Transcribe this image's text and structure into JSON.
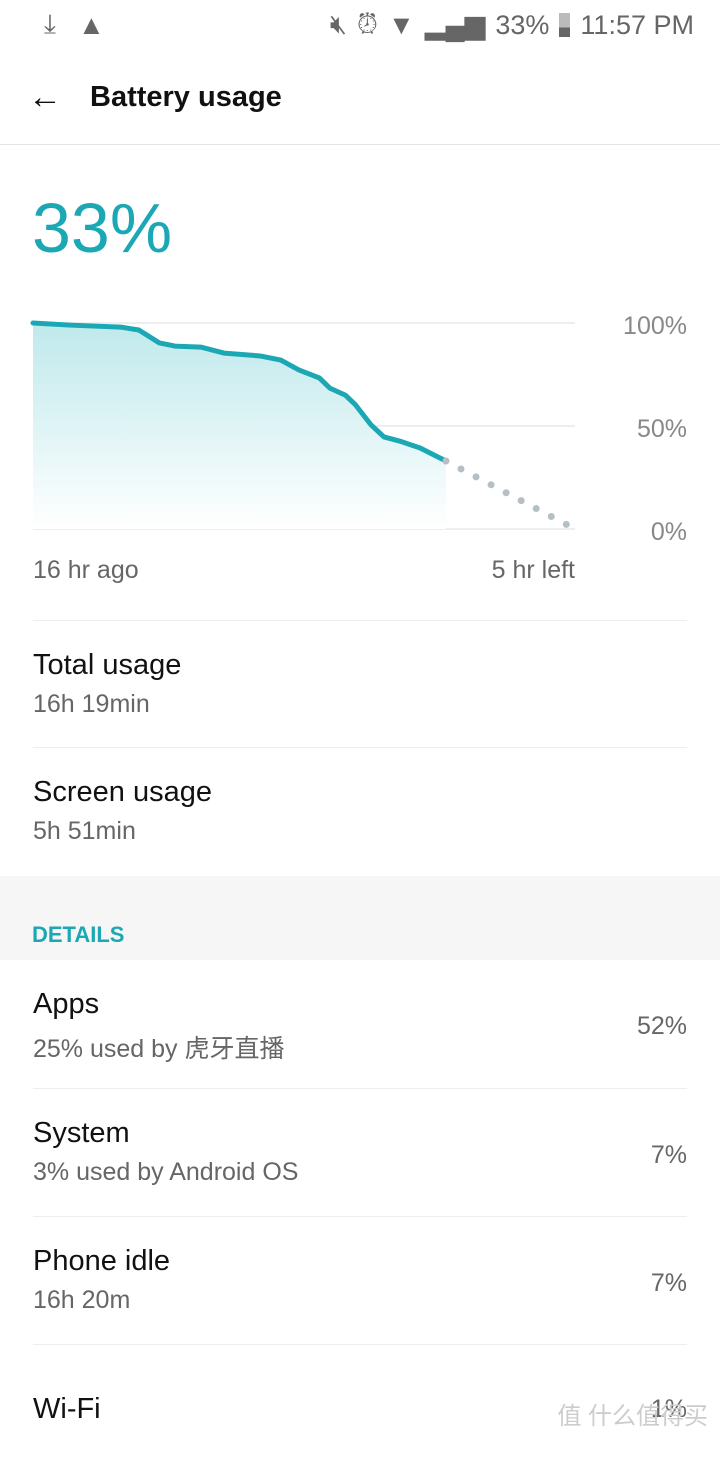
{
  "status_bar": {
    "battery": "33%",
    "time": "11:57 PM",
    "icons": [
      "download-icon",
      "image-icon",
      "mute-icon",
      "alarm-icon",
      "wifi-icon",
      "signal-icon",
      "battery-icon"
    ]
  },
  "header": {
    "title": "Battery usage"
  },
  "battery_level": "33%",
  "accent": "#1ba8b4",
  "chart_data": {
    "type": "area",
    "xlabel": "",
    "ylabel": "",
    "x_labels": [
      "16 hr ago",
      "5 hr left"
    ],
    "y_ticks": [
      "100%",
      "50%",
      "0%"
    ],
    "xlim": [
      -16,
      5
    ],
    "ylim": [
      0,
      100
    ],
    "series": [
      {
        "values": [
          [
            -16,
            100
          ],
          [
            -14.6,
            99
          ],
          [
            -12.6,
            98
          ],
          [
            -11.9,
            96.6
          ],
          [
            -11.1,
            90.3
          ],
          [
            -10.5,
            88.8
          ],
          [
            -9.5,
            88.3
          ],
          [
            -8.6,
            85.4
          ],
          [
            -7.2,
            84
          ],
          [
            -6.4,
            82
          ],
          [
            -5.7,
            77.2
          ],
          [
            -4.9,
            73.3
          ],
          [
            -4.5,
            68.4
          ],
          [
            -3.9,
            65
          ],
          [
            -3.5,
            60.2
          ],
          [
            -2.9,
            50.5
          ],
          [
            -2.4,
            44.7
          ],
          [
            -1.8,
            42.7
          ],
          [
            -1,
            39.3
          ],
          [
            0,
            33
          ]
        ]
      },
      {
        "projected": true,
        "values": [
          [
            0,
            33
          ],
          [
            5,
            0
          ]
        ]
      }
    ],
    "grid": true
  },
  "summary": [
    {
      "label": "Total usage",
      "value": "16h 19min"
    },
    {
      "label": "Screen usage",
      "value": "5h 51min"
    }
  ],
  "details_header": "DETAILS",
  "details": [
    {
      "label": "Apps",
      "sub": "25% used by 虎牙直播",
      "pct": "52%"
    },
    {
      "label": "System",
      "sub": "3% used by Android OS",
      "pct": "7%"
    },
    {
      "label": "Phone idle",
      "sub": "16h 20m",
      "pct": "7%"
    },
    {
      "label": "Wi-Fi",
      "sub": "",
      "pct": "1%"
    }
  ],
  "watermark": "值 什么值得买"
}
